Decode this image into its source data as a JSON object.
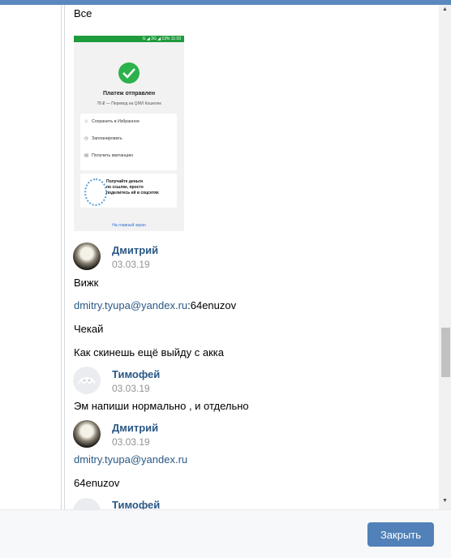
{
  "messages": {
    "top_text": "Все",
    "m1": {
      "author": "Дмитрий",
      "date": "03.03.19",
      "line1": "Вижк",
      "email": "dmitry.tyupa@yandex.ru",
      "email_suffix": ":64enuzov",
      "line3": "Чекай",
      "line4": "Как скинешь ещё выйду с акка"
    },
    "m2": {
      "author": "Тимофей",
      "date": "03.03.19",
      "line1": "Эм напиши нормально , и отдельно"
    },
    "m3": {
      "author": "Дмитрий",
      "date": "03.03.19",
      "email": "dmitry.tyupa@yandex.ru",
      "line2": "64enuzov"
    },
    "m4": {
      "author": "Тимофей"
    }
  },
  "screenshot": {
    "status_bar": "G ◢ 3G ◢ 13% 11:03",
    "title": "Платеж отправлен",
    "subtitle": "78 ₽ — Перевод на QIWI Кошелек",
    "actions": [
      {
        "icon": "star-icon",
        "label": "Сохранить в Избранное"
      },
      {
        "icon": "clock-icon",
        "label": "Запланировать"
      },
      {
        "icon": "receipt-icon",
        "label": "Получить квитанцию"
      }
    ],
    "promo": [
      "Получайте деньги",
      "по ссылке, просто",
      "поделитесь ей в соцсетях"
    ],
    "footer_link": "На главный экран"
  },
  "footer": {
    "close_label": "Закрыть"
  },
  "colors": {
    "accent": "#5181b8",
    "link": "#2a5885",
    "topbar": "#5b88bd"
  }
}
